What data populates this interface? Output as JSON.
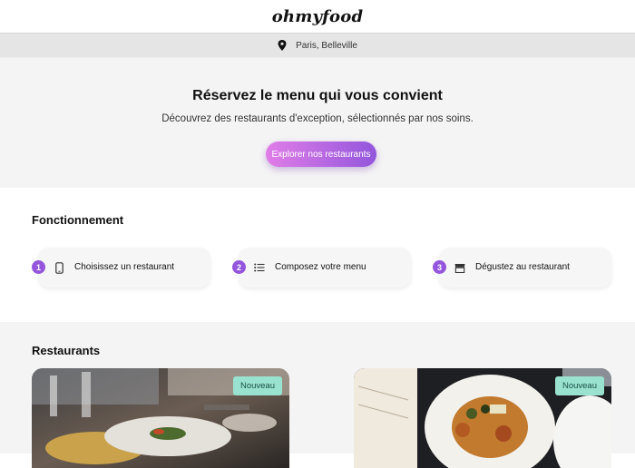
{
  "header": {
    "logo": "ohmyfood"
  },
  "location": {
    "icon": "map-pin-icon",
    "text": "Paris, Belleville"
  },
  "hero": {
    "title": "Réservez le menu qui vous convient",
    "subtitle": "Découvrez des restaurants d'exception, sélectionnés par nos soins.",
    "cta_label": "Explorer nos restaurants"
  },
  "how": {
    "title": "Fonctionnement",
    "steps": [
      {
        "number": "1",
        "icon": "phone-icon",
        "label": "Choisissez un restaurant"
      },
      {
        "number": "2",
        "icon": "list-icon",
        "label": "Composez votre menu"
      },
      {
        "number": "3",
        "icon": "store-icon",
        "label": "Dégustez au restaurant"
      }
    ]
  },
  "restaurants": {
    "title": "Restaurants",
    "cards": [
      {
        "badge": "Nouveau"
      },
      {
        "badge": "Nouveau"
      }
    ]
  },
  "colors": {
    "accent_purple": "#9356dc",
    "accent_pink": "#e07de8",
    "badge_green": "#99e2d0"
  }
}
